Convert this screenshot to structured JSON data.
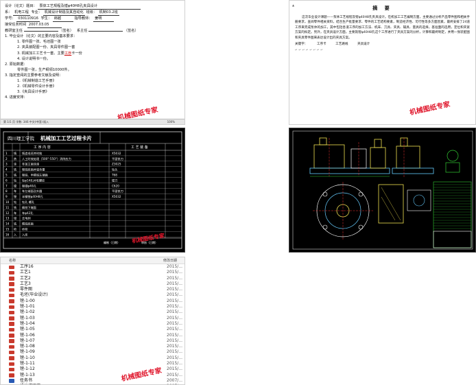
{
  "task": {
    "l1_label": "设计（论文）题目：",
    "l1_value": "泵体工艺规程及镗φ40H8孔夹具设计",
    "l2_dept_label": "系：",
    "l2_dept": "机电工程",
    "l2_major_label": "专业：",
    "l2_major": "机械设计制造及其自动化",
    "l2_class_label": "班级：",
    "l2_class": "机制03.2班",
    "l3_id_label": "学号：",
    "l3_id": "030110916",
    "l3_student_label": "学生：",
    "l3_student": "郎越",
    "l3_tutor_label": "指导教师：",
    "l3_tutor": "姜明",
    "l4_label": "接受任务时间",
    "l4_value": "2007.03.05",
    "l5_a": "教研室主任",
    "l5_b": "（签名）",
    "l5_c": "系主任",
    "l5_d": "（签名）",
    "s1": "1. 毕业设计（论文）的主要内容及基本要求：",
    "s1_1": "1. 零件图一张、毛坯图一张",
    "s1_2": "2. 夹具装配图一份、夹具零件图一套",
    "s1_3a": "3. 机械加工工艺卡一套、主要",
    "s1_3b": "工序",
    "s1_3c": "卡一份",
    "s1_4": "4. 设计说明书一份。",
    "s2": "2. 原始数据：",
    "s2_1": "零件图一张，生产纲领10000件。",
    "s3": "3. 指定查阅的主要参考文献及说明：",
    "s3_1": "1.《机械制造工艺手册》",
    "s3_2": "2.《机械零件设计手册》",
    "s3_3": "3.《夹具设计手册》",
    "s4": "4. 进度安排：",
    "status": "第 1/1 页  字数: 346  中文(中国)  插入",
    "zoom": "100%"
  },
  "abstract": {
    "topmark": "▲",
    "title": "摘 要",
    "para": "这次毕业设计课题——泵体工艺规程及镗φ40H8孔夹具设计。在机加工工艺编制方面，主要通过分析产品零件图和相关手册要求，查阅零件相关资料，结合生产批量要求、零件的工艺结构要素，制造经济性、可行性等多方面因素，最终安排了24道工序来完成泵体的加工，其中包括各道工序的加工方法、机床、刀具、夹具、辅具、量具的选择，基准面的选用，定位和夹紧方案的拟定。另外，在夹具设计方面，主要就镗φ40H8孔这个工序进行了夹具方案的分析，计算和最终制定，并用一张装配图和夹具零件图来表达设计出的夹具方案。",
    "kw_label": "关键字：",
    "kw1": "工序卡",
    "kw2": "工艺路线",
    "kw3": "夹具设计",
    "marks": "↵ ↵ ↵ ↵ ↵ ↵ ↵ ↵"
  },
  "card": {
    "school": "四川理工学院",
    "title": "机械加工工艺过程卡片",
    "col_process": "工 序 内 容",
    "col_equip": "工 艺 装 备",
    "rows": [
      [
        "1",
        "铸",
        "铸造毛坯并时效"
      ],
      [
        "2",
        "热",
        "人工时效处理（500°-550°）消除应力"
      ],
      [
        "3",
        "涂",
        "非加工面涂漆"
      ],
      [
        "4",
        "铣",
        "粗铣底面并留余量"
      ],
      [
        "5",
        "铣",
        "粗铣、半精铣左端面"
      ],
      [
        "6",
        "钻",
        "钻φ14孔并攻螺纹"
      ],
      [
        "7",
        "镗",
        "粗镗φ40孔"
      ],
      [
        "8",
        "车",
        "车左端面及外圆"
      ],
      [
        "9",
        "镗",
        "半精镗φ40H8孔"
      ],
      [
        "10",
        "钻",
        "钻孔 螺孔"
      ],
      [
        "11",
        "铣",
        "精铣下端面"
      ],
      [
        "12",
        "车",
        "车φ42孔"
      ],
      [
        "13",
        "钳",
        "去毛刺"
      ],
      [
        "14",
        "铣",
        "精铣底面"
      ],
      [
        "15",
        "检",
        "终检"
      ],
      [
        "16",
        "入",
        "入库"
      ]
    ],
    "equip": [
      "X5032",
      "平面铣刀",
      "Z3025",
      "钻头",
      "T68",
      "镗刀",
      "C620",
      "平面铣刀",
      "X5032"
    ],
    "footer_a": "编制（日期）",
    "footer_b": "审核（日期）"
  },
  "files": {
    "col_name": "名称",
    "col_date": "修改日期",
    "items": [
      {
        "name": "工序16",
        "type": "acad",
        "date": "2015/..."
      },
      {
        "name": "工艺1",
        "type": "acad",
        "date": "2015/..."
      },
      {
        "name": "工艺2",
        "type": "acad",
        "date": "2015/..."
      },
      {
        "name": "工艺3",
        "type": "acad",
        "date": "2015/..."
      },
      {
        "name": "零件图",
        "type": "acad",
        "date": "2015/..."
      },
      {
        "name": "毛坯(毕业设计)",
        "type": "acad",
        "date": "2015/..."
      },
      {
        "name": "镗-1-00",
        "type": "acad",
        "date": "2015/..."
      },
      {
        "name": "镗-1-01",
        "type": "acad",
        "date": "2015/..."
      },
      {
        "name": "镗-1-02",
        "type": "acad",
        "date": "2015/..."
      },
      {
        "name": "镗-1-03",
        "type": "acad",
        "date": "2015/..."
      },
      {
        "name": "镗-1-04",
        "type": "acad",
        "date": "2015/..."
      },
      {
        "name": "镗-1-05",
        "type": "acad",
        "date": "2015/..."
      },
      {
        "name": "镗-1-06",
        "type": "acad",
        "date": "2015/..."
      },
      {
        "name": "镗-1-07",
        "type": "acad",
        "date": "2015/..."
      },
      {
        "name": "镗-1-08",
        "type": "acad",
        "date": "2015/..."
      },
      {
        "name": "镗-1-09",
        "type": "acad",
        "date": "2015/..."
      },
      {
        "name": "镗-1-10",
        "type": "acad",
        "date": "2015/..."
      },
      {
        "name": "镗-1-11",
        "type": "acad",
        "date": "2015/..."
      },
      {
        "name": "镗-1-12",
        "type": "acad",
        "date": "2015/..."
      },
      {
        "name": "镗-1-13",
        "type": "acad",
        "date": "2015/..."
      },
      {
        "name": "任务书",
        "type": "doc",
        "date": "2007/..."
      },
      {
        "name": "设计说明书",
        "type": "doc",
        "date": "2007/..."
      }
    ]
  },
  "watermark": "机械图纸专家"
}
